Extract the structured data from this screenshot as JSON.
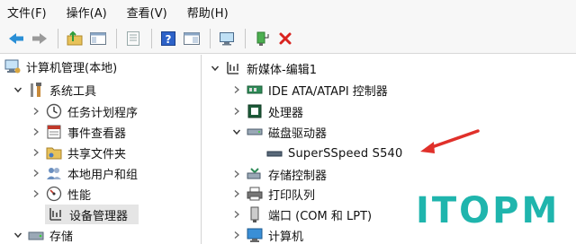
{
  "menu": {
    "file": "文件(F)",
    "action": "操作(A)",
    "view": "查看(V)",
    "help": "帮助(H)"
  },
  "left_tree": {
    "root": "计算机管理(本地)",
    "system_tools": "系统工具",
    "task_scheduler": "任务计划程序",
    "event_viewer": "事件查看器",
    "shared_folders": "共享文件夹",
    "local_users": "本地用户和组",
    "performance": "性能",
    "device_manager": "设备管理器",
    "storage": "存储"
  },
  "right_tree": {
    "computer": "新媒体-编辑1",
    "ide": "IDE ATA/ATAPI 控制器",
    "processor": "处理器",
    "disk_drives": "磁盘驱动器",
    "ssd": "SuperSSpeed S540",
    "storage_controllers": "存储控制器",
    "print_queues": "打印队列",
    "ports": "端口 (COM 和 LPT)",
    "computer_node": "计算机"
  },
  "watermark": "ITOPM",
  "colors": {
    "arrow": "#e0302a",
    "watermark": "#1fb5ad",
    "selected_bg": "#e5e5e5"
  }
}
